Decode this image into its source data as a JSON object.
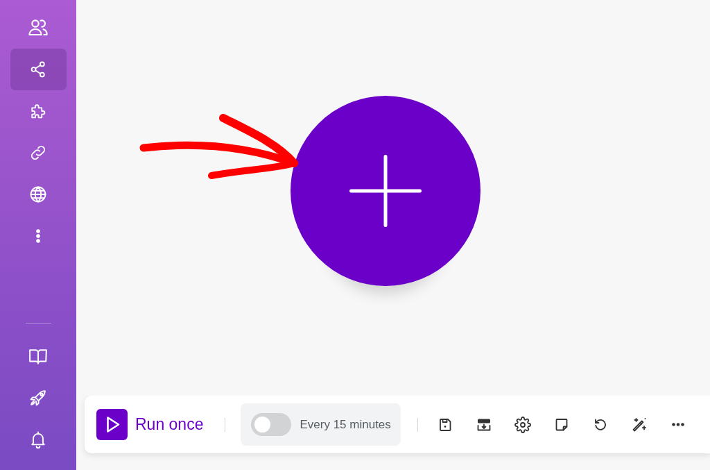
{
  "sidebar": {
    "top_items": [
      {
        "selected": false
      },
      {
        "selected": true
      },
      {
        "selected": false
      },
      {
        "selected": false
      },
      {
        "selected": false
      },
      {
        "selected": false
      }
    ],
    "bottom_items": [
      {
        "selected": false
      },
      {
        "selected": false
      },
      {
        "selected": false
      }
    ]
  },
  "canvas": {
    "annotation": {
      "kind": "arrow"
    }
  },
  "toolbar": {
    "run_button": {
      "label": "Run once"
    },
    "schedule": {
      "on": false,
      "label": "Every 15 minutes"
    }
  }
}
